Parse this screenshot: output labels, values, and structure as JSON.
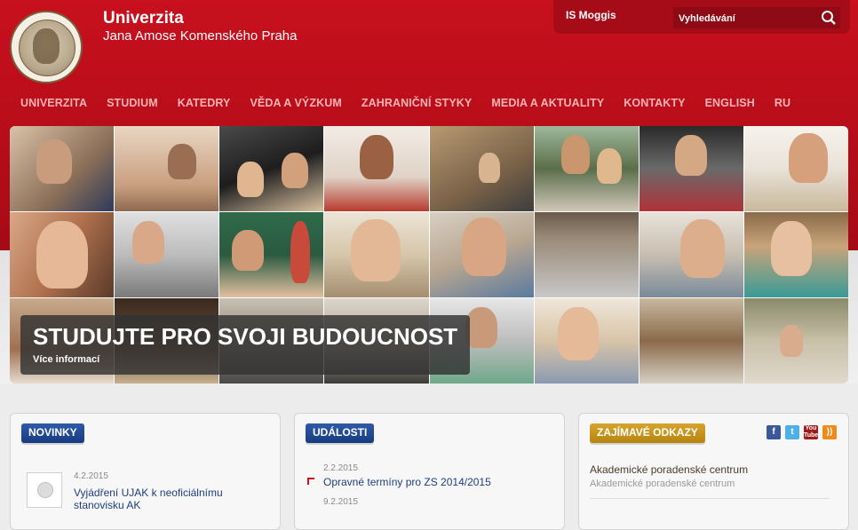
{
  "brand": {
    "title": "Univerzita",
    "subtitle": "Jana Amose Komenského Praha"
  },
  "topbar": {
    "is_link": "IS Moggis",
    "search_placeholder": "Vyhledávání"
  },
  "nav": [
    "UNIVERZITA",
    "STUDIUM",
    "KATEDRY",
    "VĚDA A VÝZKUM",
    "ZAHRANIČNÍ STYKY",
    "MEDIA A AKTUALITY",
    "KONTAKTY",
    "ENGLISH",
    "RU"
  ],
  "banner": {
    "title": "STUDUJTE PRO SVOJI BUDOUCNOST",
    "more": "Více informací"
  },
  "news": {
    "heading": "NOVINKY",
    "items": [
      {
        "date": "4.2.2015",
        "title": "Vyjádření UJAK k neoficiálnímu stanovisku AK"
      }
    ]
  },
  "events": {
    "heading": "UDÁLOSTI",
    "items": [
      {
        "date": "2.2.2015",
        "title": "Opravné termíny pro ZS 2014/2015"
      },
      {
        "date": "9.2.2015",
        "title": ""
      }
    ]
  },
  "links": {
    "heading": "ZAJÍMAVÉ ODKAZY",
    "items": [
      {
        "title": "Akademické poradenské centrum",
        "subtitle": "Akademické poradenské centrum"
      }
    ],
    "social": [
      "facebook-icon",
      "twitter-icon",
      "youtube-icon",
      "rss-icon"
    ]
  },
  "colors": {
    "brand_red": "#c8101e",
    "nav_text": "#ffb4b4",
    "tag_blue": "#1f4690",
    "tag_gold": "#c9971d",
    "link_blue": "#1d3f7e"
  }
}
